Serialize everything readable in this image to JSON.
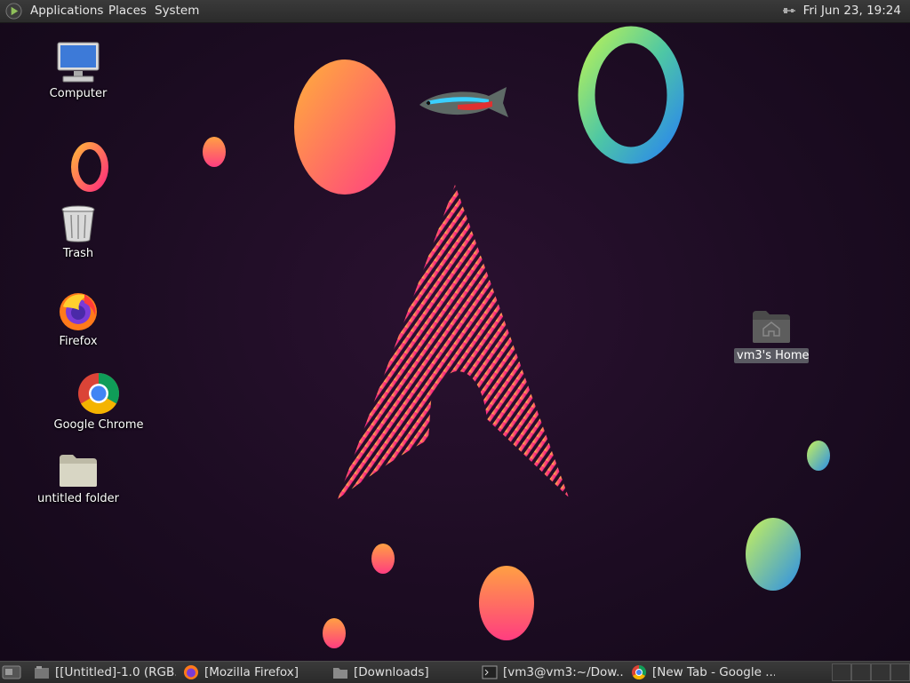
{
  "top_panel": {
    "menus": [
      "Applications",
      "Places",
      "System"
    ],
    "clock": "Fri Jun 23, 19:24"
  },
  "desktop_icons": {
    "computer": "Computer",
    "trash": "Trash",
    "firefox": "Firefox",
    "chrome": "Google Chrome",
    "untitled_folder": "untitled folder",
    "home": "vm3's Home"
  },
  "taskbar": {
    "tasks": [
      "[[Untitled]-1.0 (RGB...",
      "[Mozilla Firefox]",
      "[Downloads]",
      "[vm3@vm3:~/Dow...",
      "[New Tab - Google ..."
    ]
  },
  "colors": {
    "background": "#1c0c22",
    "panel": "#2f2f2f",
    "accent_pink": "#ff2f8a",
    "accent_orange": "#ff9a3c"
  }
}
